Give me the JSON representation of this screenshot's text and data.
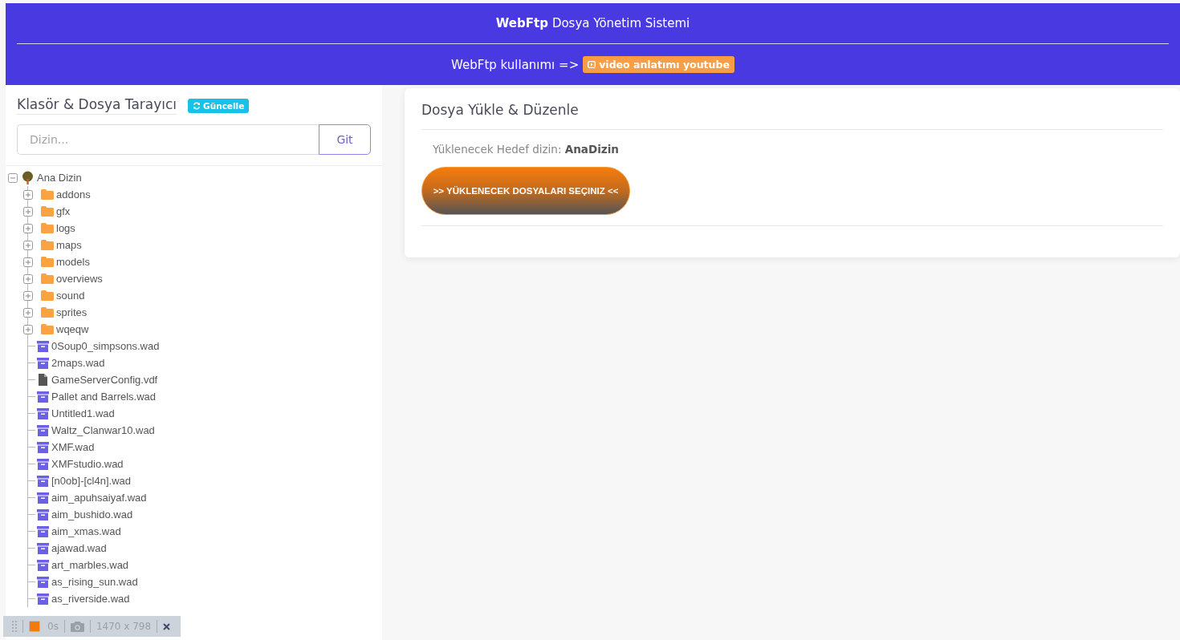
{
  "header": {
    "title_bold": "WebFtp",
    "title_rest": "Dosya Yönetim Sistemi",
    "usage_text": "WebFtp kullanımı =>",
    "video_link": "video anlatımı youtube"
  },
  "browser": {
    "title": "Klasör & Dosya Tarayıcı",
    "refresh_button": "Güncelle",
    "path_field": {
      "placeholder": "Dizin..."
    },
    "go_button": "Git",
    "tree": {
      "label": "Ana Dizin",
      "kind": "root",
      "expanded": true,
      "children": [
        {
          "label": "addons",
          "kind": "folder",
          "expanded": false
        },
        {
          "label": "gfx",
          "kind": "folder",
          "expanded": false
        },
        {
          "label": "logs",
          "kind": "folder",
          "expanded": false
        },
        {
          "label": "maps",
          "kind": "folder",
          "expanded": false
        },
        {
          "label": "models",
          "kind": "folder",
          "expanded": false
        },
        {
          "label": "overviews",
          "kind": "folder",
          "expanded": false
        },
        {
          "label": "sound",
          "kind": "folder",
          "expanded": false
        },
        {
          "label": "sprites",
          "kind": "folder",
          "expanded": false
        },
        {
          "label": "wqeqw",
          "kind": "folder",
          "expanded": false
        },
        {
          "label": "0Soup0_simpsons.wad",
          "kind": "archive"
        },
        {
          "label": "2maps.wad",
          "kind": "archive"
        },
        {
          "label": "GameServerConfig.vdf",
          "kind": "document"
        },
        {
          "label": "Pallet and Barrels.wad",
          "kind": "archive"
        },
        {
          "label": "Untitled1.wad",
          "kind": "archive"
        },
        {
          "label": "Waltz_Clanwar10.wad",
          "kind": "archive"
        },
        {
          "label": "XMF.wad",
          "kind": "archive"
        },
        {
          "label": "XMFstudio.wad",
          "kind": "archive"
        },
        {
          "label": "[n0ob]-[cl4n].wad",
          "kind": "archive"
        },
        {
          "label": "aim_apuhsaiyaf.wad",
          "kind": "archive"
        },
        {
          "label": "aim_bushido.wad",
          "kind": "archive"
        },
        {
          "label": "aim_xmas.wad",
          "kind": "archive"
        },
        {
          "label": "ajawad.wad",
          "kind": "archive"
        },
        {
          "label": "art_marbles.wad",
          "kind": "archive"
        },
        {
          "label": "as_rising_sun.wad",
          "kind": "archive"
        },
        {
          "label": "as_riverside.wad",
          "kind": "archive"
        }
      ]
    }
  },
  "upload": {
    "title": "Dosya Yükle & Düzenle",
    "target_label": "Yüklenecek Hedef dizin:",
    "target_value": "AnaDizin",
    "select_button": ">> YÜKLENECEK DOSYALARI SEÇINIZ <<"
  },
  "recorder_bar": {
    "timer": "0s",
    "size": "1470 x 798"
  }
}
